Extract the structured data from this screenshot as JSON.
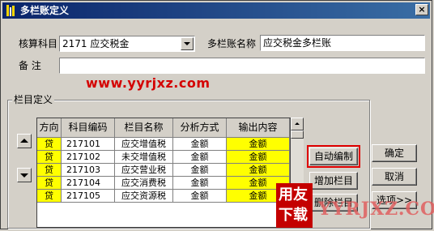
{
  "window": {
    "title": "多栏账定义",
    "close_symbol": "×"
  },
  "form": {
    "subject_label": "核算科目",
    "subject_value": "2171 应交税金",
    "ledger_name_label": "多栏账名称",
    "ledger_name_value": "应交税金多栏账",
    "remark_label": "备  注",
    "remark_value": ""
  },
  "watermark": "www.yyrjxz.com",
  "group": {
    "title": "栏目定义"
  },
  "table": {
    "columns": [
      "方向",
      "科目编码",
      "栏目名称",
      "分析方式",
      "输出内容"
    ],
    "rows": [
      [
        "贷",
        "217101",
        "应交增值税",
        "金额",
        "金额"
      ],
      [
        "贷",
        "217102",
        "未交增值税",
        "金额",
        "金额"
      ],
      [
        "贷",
        "217103",
        "应交营业税",
        "金额",
        "金额"
      ],
      [
        "贷",
        "217104",
        "应交消费税",
        "金额",
        "金额"
      ],
      [
        "贷",
        "217105",
        "应交资源税",
        "金额",
        "金额"
      ]
    ]
  },
  "buttons": {
    "auto_compile": "自动编制",
    "add_column": "增加栏目",
    "delete_column": "删除栏目",
    "ok": "确定",
    "cancel": "取消",
    "options": "选项>>"
  },
  "logo": {
    "glyph_1": "用友",
    "glyph_2": "下载",
    "text": "YYRJXZ.COM"
  },
  "colors": {
    "highlight": "#ffff00",
    "accent": "#e00000",
    "titlebar": "#0a246a"
  }
}
